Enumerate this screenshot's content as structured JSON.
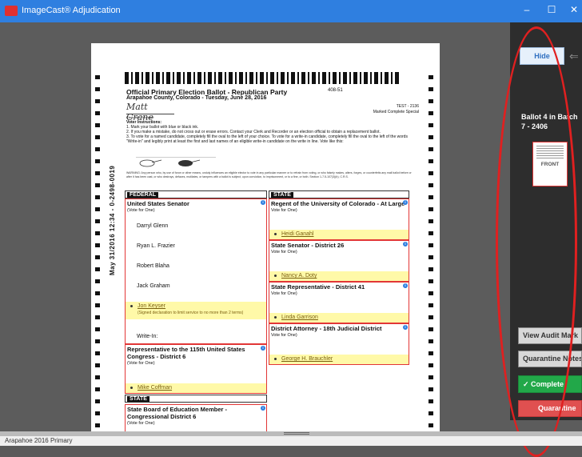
{
  "window": {
    "title": "ImageCast® Adjudication",
    "min": "–",
    "max": "☐",
    "close": "✕"
  },
  "ballot": {
    "title": "Official Primary Election Ballot - Republican Party",
    "subtitle": "Arapahoe County, Colorado - Tuesday, June 28, 2016",
    "number": "408-51",
    "test": "TEST - 2136",
    "marked": "Marked Complete Special",
    "signature": "Matt Crane",
    "clerk": "Clerk and Recorder",
    "instructions_heading": "Voter Instructions:",
    "instructions": [
      "1.   Mark your ballot with blue or black ink.",
      "2.   If you make a mistake, do not cross out or erase errors. Contact your Clerk and Recorder or an election official to obtain a replacement ballot.",
      "3.   To vote for a named candidate, completely fill the oval to the left of your choice.  To vote for a write-in candidate, completely fill the oval to the left of the words \"Write-in\" and legibly print at least the first and last names of an eligible write-in candidate on the write in line.  Vote like this:"
    ],
    "warning": "WARNING: Any person who, by use of force or other means, unduly influences an eligible elector to vote in any particular manner or to refrain from voting, or who falsely makes, alters, forges, or counterfeits any mail ballot before or after it has been cast, or who destroys, defaces, mutilates, or tampers with a ballot is subject, upon conviction, to imprisonment, or to a fine, or both. Section 1-7.5-107(3)(b), C.R.S.",
    "side_print": "May 31/2016 12:34 - 0-2498-0019",
    "section_federal": "FEDERAL",
    "section_state": "STATE",
    "section_state2": "STATE",
    "contests": {
      "senator": {
        "name": "United States Senator",
        "vfo": "(Vote for One)",
        "cands": [
          "Darryl Glenn",
          "Ryan L. Frazier",
          "Robert Blaha",
          "Jack Graham"
        ],
        "chosen": "Jon Keyser",
        "note": "(Signed declaration to limit service to no more than 2 terms)",
        "writein": "Write-In:"
      },
      "rep115": {
        "name": "Representative to the 115th United States Congress - District 6",
        "vfo": "(Vote for One)",
        "chosen": "Mike Coffman"
      },
      "regent": {
        "name": "Regent of the University of Colorado - At Large",
        "vfo": "Vote for One)",
        "chosen": "Heidi Ganahl"
      },
      "stsen": {
        "name": "State Senator - District 26",
        "vfo": "Vote for One)",
        "chosen": "Nancy A. Doty"
      },
      "strep": {
        "name": "State Representative - District 41",
        "vfo": "Vote for One)",
        "chosen": "Linda Garrison"
      },
      "da": {
        "name": "District Attorney - 18th Judicial District",
        "vfo": "Vote for One)",
        "chosen": "George H. Brauchler"
      },
      "sboe": {
        "name": "State Board of Education Member - Congressional District 6",
        "vfo": "(Vote for One)"
      }
    }
  },
  "panel": {
    "hide": "Hide",
    "ballot_info": "Ballot 4 in Batch 7 - 2406",
    "thumb_label": "FRONT",
    "audit": "View Audit Mark",
    "quarantine_notes": "Quarantine Notes",
    "complete": "Complete",
    "quarantine": "Quarantine"
  },
  "status": "Arapahoe 2016 Primary"
}
